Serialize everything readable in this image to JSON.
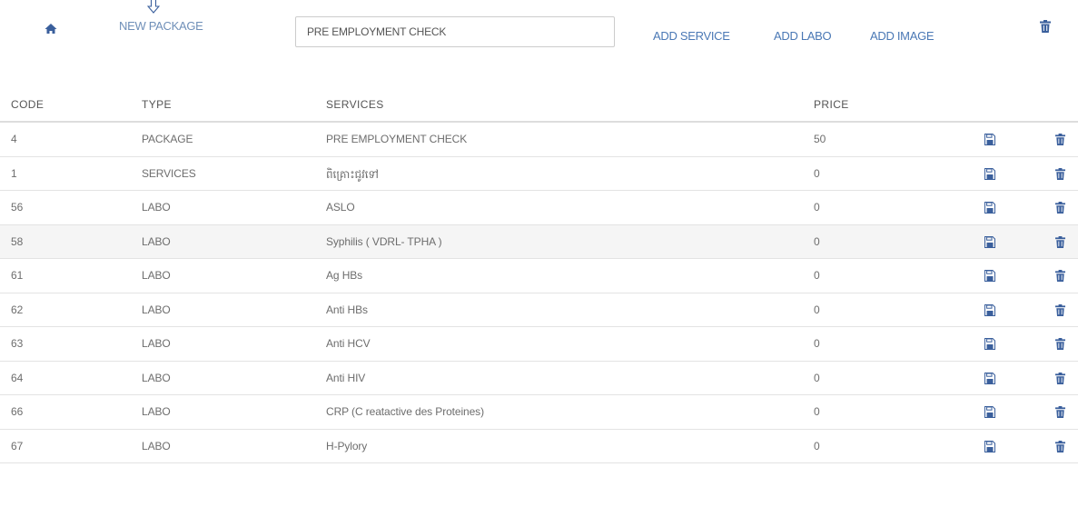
{
  "colors": {
    "link": "#4a78b5",
    "icon": "#3a5f9c",
    "header_border": "#dddddd",
    "row_border": "#e3e3e3",
    "stripe": "#f5f5f5"
  },
  "toolbar": {
    "home_icon": "home-icon",
    "new_package_label": "NEW PACKAGE",
    "package_name_value": "PRE EMPLOYMENT CHECK",
    "add_service_label": "ADD SERVICE",
    "add_labo_label": "ADD LABO",
    "add_image_label": "ADD IMAGE",
    "delete_icon": "trash-icon"
  },
  "table": {
    "headers": {
      "code": "CODE",
      "type": "TYPE",
      "services": "SERVICES",
      "price": "PRICE"
    },
    "rows": [
      {
        "code": "4",
        "type": "PACKAGE",
        "service": "PRE EMPLOYMENT CHECK",
        "price": "50"
      },
      {
        "code": "1",
        "type": "SERVICES",
        "service": "ពិគ្រោះជូវទៅ",
        "price": "0"
      },
      {
        "code": "56",
        "type": "LABO",
        "service": "ASLO",
        "price": "0"
      },
      {
        "code": "58",
        "type": "LABO",
        "service": "Syphilis ( VDRL- TPHA )",
        "price": "0"
      },
      {
        "code": "61",
        "type": "LABO",
        "service": "Ag HBs",
        "price": "0"
      },
      {
        "code": "62",
        "type": "LABO",
        "service": "Anti HBs",
        "price": "0"
      },
      {
        "code": "63",
        "type": "LABO",
        "service": "Anti HCV",
        "price": "0"
      },
      {
        "code": "64",
        "type": "LABO",
        "service": "Anti HIV",
        "price": "0"
      },
      {
        "code": "66",
        "type": "LABO",
        "service": "CRP (C reatactive des Proteines)",
        "price": "0"
      },
      {
        "code": "67",
        "type": "LABO",
        "service": "H-Pylory",
        "price": "0"
      }
    ]
  }
}
